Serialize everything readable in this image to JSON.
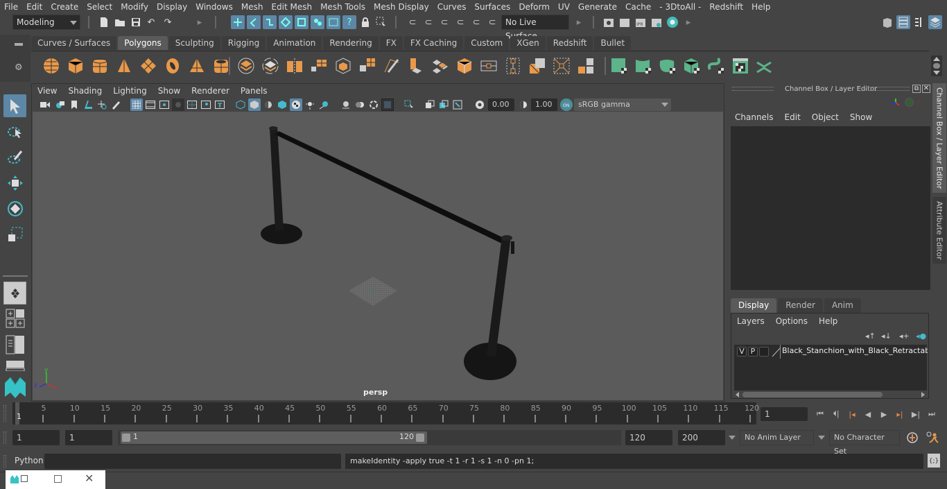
{
  "menubar": {
    "items": [
      "File",
      "Edit",
      "Create",
      "Select",
      "Modify",
      "Display",
      "Windows",
      "Mesh",
      "Edit Mesh",
      "Mesh Tools",
      "Mesh Display",
      "Curves",
      "Surfaces",
      "Deform",
      "UV",
      "Generate",
      "Cache",
      "- 3DtoAll -",
      "Redshift",
      "Help"
    ]
  },
  "statusline": {
    "mode_dropdown": "Modeling",
    "live_surface": "No Live Surface"
  },
  "shelf": {
    "tabs": [
      {
        "label": "Curves / Surfaces",
        "active": false
      },
      {
        "label": "Polygons",
        "active": true
      },
      {
        "label": "Sculpting",
        "active": false
      },
      {
        "label": "Rigging",
        "active": false
      },
      {
        "label": "Animation",
        "active": false
      },
      {
        "label": "Rendering",
        "active": false
      },
      {
        "label": "FX",
        "active": false
      },
      {
        "label": "FX Caching",
        "active": false
      },
      {
        "label": "Custom",
        "active": false
      },
      {
        "label": "XGen",
        "active": false
      },
      {
        "label": "Redshift",
        "active": false
      },
      {
        "label": "Bullet",
        "active": false
      }
    ],
    "poly_color": "#e8994a",
    "uv_color": "#5db38a"
  },
  "viewport": {
    "menu": [
      "View",
      "Shading",
      "Lighting",
      "Show",
      "Renderer",
      "Panels"
    ],
    "exposure": "0.00",
    "gamma": "1.00",
    "color_space": "sRGB gamma",
    "camera_label": "persp",
    "axis": {
      "x": "x",
      "y": "y",
      "z": "z"
    }
  },
  "channelbox": {
    "title": "Channel Box / Layer Editor",
    "menu": [
      "Channels",
      "Edit",
      "Object",
      "Show"
    ],
    "layer_tabs": [
      {
        "label": "Display",
        "active": true
      },
      {
        "label": "Render",
        "active": false
      },
      {
        "label": "Anim",
        "active": false
      }
    ],
    "layer_menu": [
      "Layers",
      "Options",
      "Help"
    ],
    "layers": [
      {
        "v": "V",
        "p": "P",
        "name": "Black_Stanchion_with_Black_Retractable_Belt"
      }
    ]
  },
  "side_tabs": [
    "Channel Box / Layer Editor",
    "Attribute Editor"
  ],
  "timeline": {
    "ticks": [
      5,
      10,
      15,
      20,
      25,
      30,
      35,
      40,
      45,
      50,
      55,
      60,
      65,
      70,
      75,
      80,
      85,
      90,
      95,
      100,
      105,
      110,
      115,
      120
    ],
    "start": 1,
    "end": 120,
    "current_frame_marker": "1",
    "current_frame": "1"
  },
  "range": {
    "start_field": "1",
    "playback_start": "1",
    "range_min_label": "1",
    "range_max_label": "120",
    "playback_end": "120",
    "end_field": "200",
    "anim_layer": "No Anim Layer",
    "character_set": "No Character Set"
  },
  "command": {
    "language": "Python",
    "input": "",
    "result": "makeIdentity -apply true -t 1 -r 1 -s 1 -n 0 -pn 1;"
  }
}
